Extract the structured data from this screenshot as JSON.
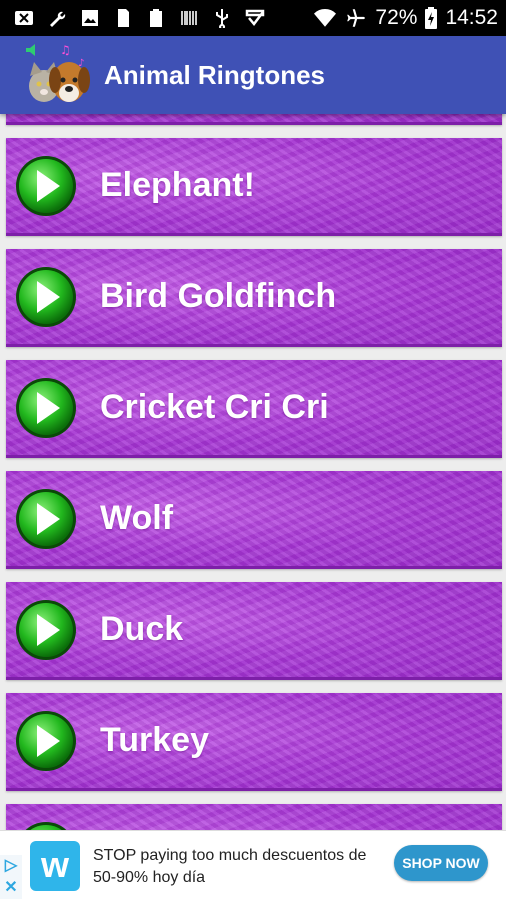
{
  "status_bar": {
    "battery_percent": "72%",
    "time": "14:52",
    "icons": [
      "close-box-icon",
      "wrench-icon",
      "image-icon",
      "sd-card-icon",
      "clipboard-icon",
      "barcode-icon",
      "usb-icon",
      "download-check-icon",
      "wifi-icon",
      "airplane-icon",
      "battery-charging-icon"
    ]
  },
  "app_bar": {
    "title": "Animal Ringtones",
    "icon": "cat-dog-app-icon"
  },
  "list": {
    "items": [
      {
        "label": ""
      },
      {
        "label": "Elephant!"
      },
      {
        "label": "Bird Goldfinch"
      },
      {
        "label": "Cricket Cri Cri"
      },
      {
        "label": "Wolf"
      },
      {
        "label": "Duck"
      },
      {
        "label": "Turkey"
      },
      {
        "label": ""
      }
    ],
    "colors": {
      "row": "#a838d6",
      "play": "#22b81e"
    }
  },
  "ad": {
    "text": "STOP paying too much descuentos de 50-90% hoy día",
    "button": "SHOP NOW",
    "logo_letter": "w",
    "badge_info": "▷",
    "badge_close": "✕"
  }
}
